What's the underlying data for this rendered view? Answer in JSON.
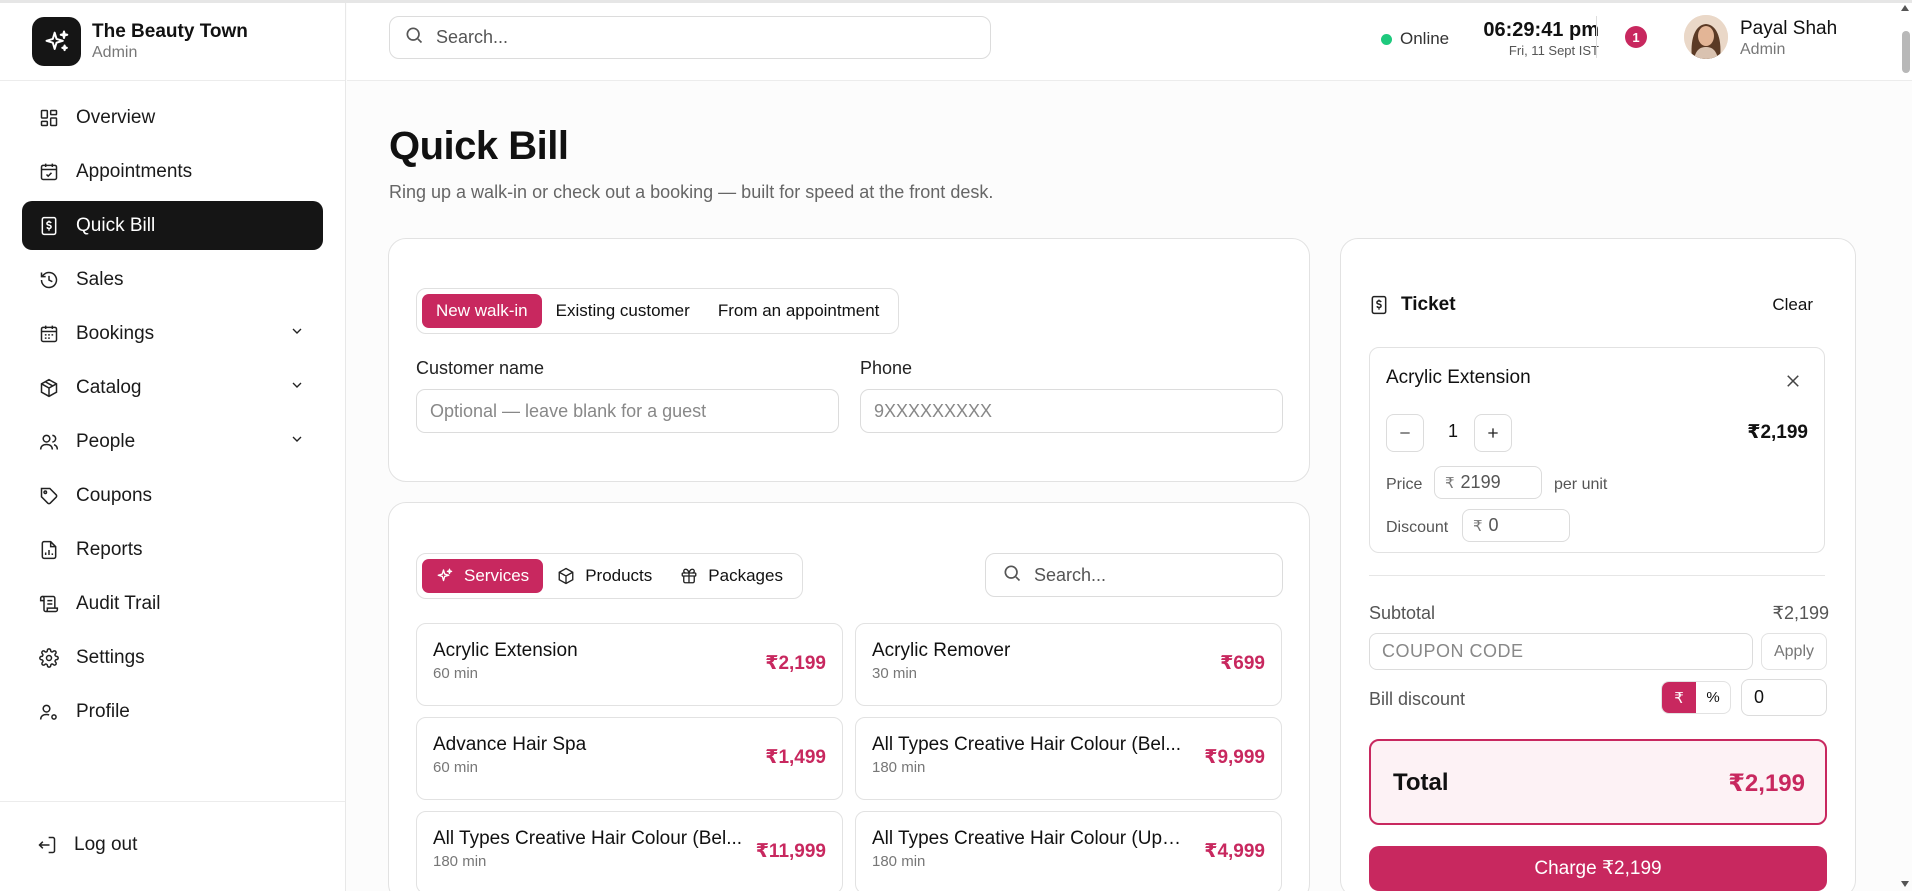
{
  "brand": {
    "name": "The Beauty Town",
    "role": "Admin"
  },
  "nav": {
    "items": [
      {
        "label": "Overview"
      },
      {
        "label": "Appointments"
      },
      {
        "label": "Quick Bill"
      },
      {
        "label": "Sales"
      },
      {
        "label": "Bookings"
      },
      {
        "label": "Catalog"
      },
      {
        "label": "People"
      },
      {
        "label": "Coupons"
      },
      {
        "label": "Reports"
      },
      {
        "label": "Audit Trail"
      },
      {
        "label": "Settings"
      },
      {
        "label": "Profile"
      }
    ],
    "logout": "Log out"
  },
  "topbar": {
    "search_placeholder": "Search...",
    "status": "Online",
    "time": "06:29:41 pm",
    "date": "Fri, 11 Sept IST",
    "notifications": "1",
    "user_name": "Payal Shah",
    "user_role": "Admin"
  },
  "page": {
    "title": "Quick Bill",
    "subtitle": "Ring up a walk-in or check out a booking — built for speed at the front desk."
  },
  "customer": {
    "tabs": [
      "New walk-in",
      "Existing customer",
      "From an appointment"
    ],
    "name_label": "Customer name",
    "name_placeholder": "Optional — leave blank for a guest",
    "phone_label": "Phone",
    "phone_placeholder": "9XXXXXXXXX"
  },
  "catalog": {
    "tabs": [
      "Services",
      "Products",
      "Packages"
    ],
    "search_placeholder": "Search...",
    "items": [
      {
        "name": "Acrylic Extension",
        "duration": "60 min",
        "price": "₹2,199"
      },
      {
        "name": "Acrylic Remover",
        "duration": "30 min",
        "price": "₹699"
      },
      {
        "name": "Advance Hair Spa",
        "duration": "60 min",
        "price": "₹1,499"
      },
      {
        "name": "All Types Creative Hair Colour (Bel...",
        "duration": "180 min",
        "price": "₹9,999"
      },
      {
        "name": "All Types Creative Hair Colour (Bel...",
        "duration": "180 min",
        "price": "₹11,999"
      },
      {
        "name": "All Types Creative Hair Colour (Upt...",
        "duration": "180 min",
        "price": "₹4,999"
      }
    ]
  },
  "ticket": {
    "title": "Ticket",
    "clear": "Clear",
    "line": {
      "name": "Acrylic Extension",
      "qty": "1",
      "total": "₹2,199",
      "price_label": "Price",
      "currency": "₹",
      "price": "2199",
      "per_unit": "per unit",
      "discount_label": "Discount",
      "discount": "0"
    },
    "subtotal_label": "Subtotal",
    "subtotal": "₹2,199",
    "coupon_placeholder": "COUPON CODE",
    "apply": "Apply",
    "bill_discount_label": "Bill discount",
    "mode_amount": "₹",
    "mode_percent": "%",
    "bill_discount": "0",
    "total_label": "Total",
    "total": "₹2,199",
    "charge": "Charge ₹2,199"
  },
  "colors": {
    "accent": "#c8285f",
    "dark": "#151515",
    "online": "#1ec97d"
  }
}
